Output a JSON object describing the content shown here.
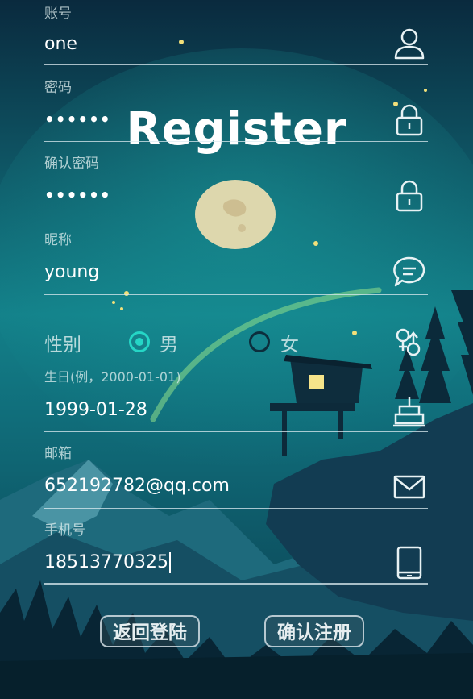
{
  "title": "Register",
  "fields": {
    "account": {
      "label": "账号",
      "value": "one",
      "icon": "user-icon"
    },
    "password": {
      "label": "密码",
      "value": "••••••",
      "icon": "lock-icon"
    },
    "confirm_password": {
      "label": "确认密码",
      "value": "••••••",
      "icon": "lock-icon"
    },
    "nickname": {
      "label": "昵称",
      "value": "young",
      "icon": "chat-bubble-icon"
    },
    "birthday": {
      "label": "生日(例，2000-01-01)",
      "value": "1999-01-28",
      "icon": "birthday-cake-icon"
    },
    "email": {
      "label": "邮箱",
      "value": "652192782@qq.com",
      "icon": "mail-icon"
    },
    "phone": {
      "label": "手机号",
      "value": "18513770325",
      "icon": "mobile-phone-icon"
    }
  },
  "gender": {
    "label": "性别",
    "options": [
      "男",
      "女"
    ],
    "selected": "男",
    "icon": "gender-icon"
  },
  "buttons": {
    "back": "返回登陆",
    "confirm": "确认注册"
  },
  "colors": {
    "accent": "#25d6c6",
    "sky_top": "#0a2f44",
    "sky_mid": "#137f87"
  }
}
